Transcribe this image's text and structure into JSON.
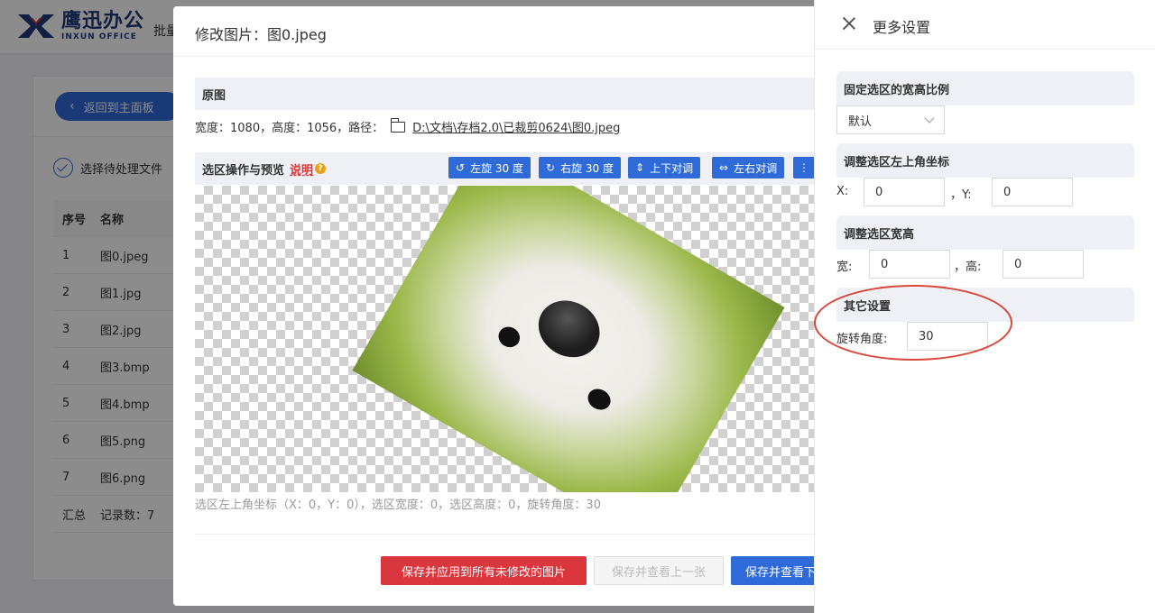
{
  "app": {
    "logo_cn": "鹰迅办公",
    "logo_en": "INXUN OFFICE",
    "top_menu": "批量",
    "back_label": "返回到主面板",
    "step_label": "选择待处理文件",
    "table": {
      "headers": [
        "序号",
        "名称"
      ],
      "rows": [
        [
          "1",
          "图0.jpeg"
        ],
        [
          "2",
          "图1.jpg"
        ],
        [
          "3",
          "图2.jpg"
        ],
        [
          "4",
          "图3.bmp"
        ],
        [
          "5",
          "图4.bmp"
        ],
        [
          "6",
          "图5.png"
        ],
        [
          "7",
          "图6.png"
        ],
        [
          "汇总",
          "记录数：7"
        ]
      ]
    }
  },
  "dialog": {
    "title": "修改图片：图0.jpeg",
    "original_section": "原图",
    "path_prefix": "宽度：1080，高度：1056，路径：",
    "path": "D:\\文档\\存档2.0\\已裁剪0624\\图0.jpeg",
    "preview_section": "选区操作与预览",
    "explain": "说明",
    "toolbar": [
      {
        "label": "左旋 30 度",
        "icon": "↺"
      },
      {
        "label": "右旋 30 度",
        "icon": "↻"
      },
      {
        "label": "上下对调",
        "icon": "⇕"
      },
      {
        "label": "左右对调",
        "icon": "⇔"
      },
      {
        "label": "",
        "icon": "⋮"
      }
    ],
    "status": "选区左上角坐标（X：0，Y：0），选区宽度：0，选区高度：0，旋转角度：30",
    "buttons": {
      "apply_all": "保存并应用到所有未修改的图片",
      "prev": "保存并查看上一张",
      "next": "保存并查看下"
    }
  },
  "drawer": {
    "title": "更多设置",
    "sections": {
      "ratio": "固定选区的宽高比例",
      "coords": "调整选区左上角坐标",
      "size": "调整选区宽高",
      "other": "其它设置"
    },
    "ratio_value": "默认",
    "x_label": "X:",
    "x_value": "0",
    "y_label": "，Y:",
    "y_value": "0",
    "w_label": "宽:",
    "w_value": "0",
    "h_label": "，高:",
    "h_value": "0",
    "rotate_label": "旋转角度:",
    "rotate_value": "30"
  },
  "colors": {
    "primary": "#2f6bd8",
    "danger": "#d9363e",
    "highlight_oval": "#d9463a"
  }
}
